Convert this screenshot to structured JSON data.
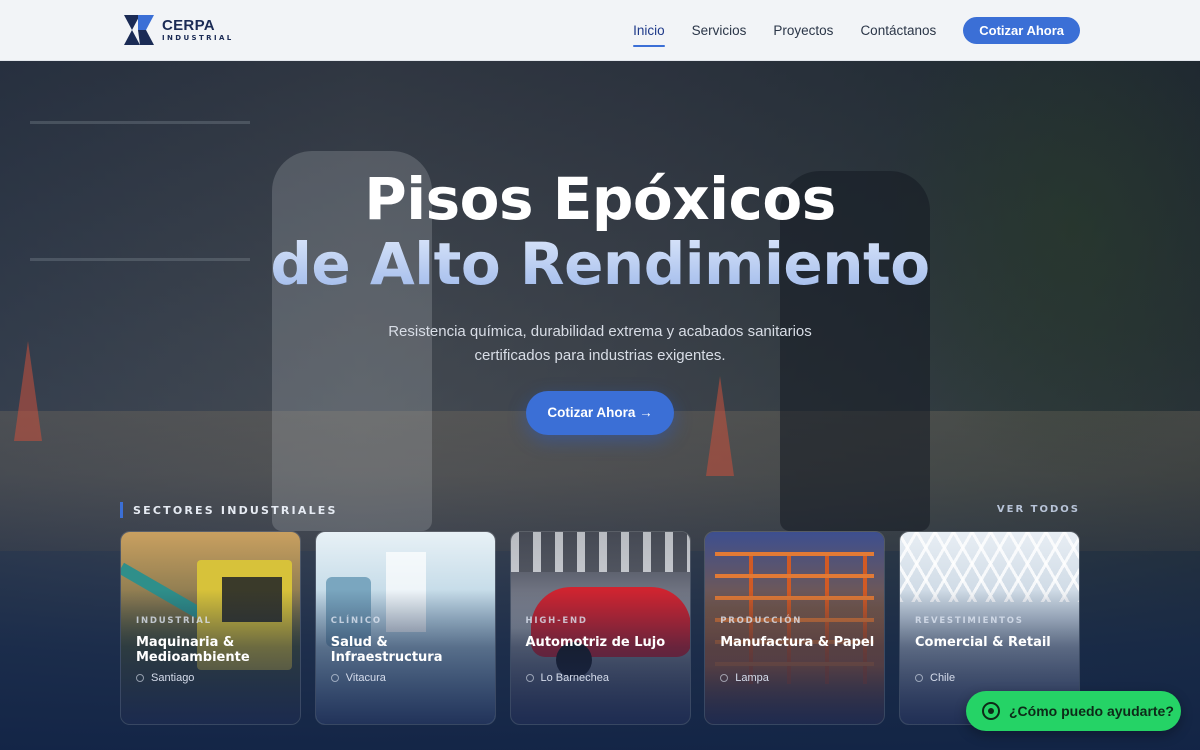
{
  "brand": {
    "name": "CERPA",
    "sub": "INDUSTRIAL"
  },
  "nav": {
    "links": [
      "Inicio",
      "Servicios",
      "Proyectos",
      "Contáctanos"
    ],
    "active": "Inicio",
    "cta": "Cotizar Ahora"
  },
  "hero": {
    "title_line1": "Pisos Epóxicos",
    "title_line2": "de Alto Rendimiento",
    "subtitle": "Resistencia química, durabilidad extrema y acabados sanitarios certificados para industrias exigentes.",
    "cta": "Cotizar Ahora →"
  },
  "sectors": {
    "heading": "SECTORES INDUSTRIALES",
    "see_all": "VER TODOS",
    "items": [
      {
        "tag": "INDUSTRIAL",
        "title": "Maquinaria & Medioambiente",
        "location": "Santiago"
      },
      {
        "tag": "CLÍNICO",
        "title": "Salud & Infraestructura",
        "location": "Vitacura"
      },
      {
        "tag": "HIGH-END",
        "title": "Automotriz de Lujo",
        "location": "Lo Barnechea"
      },
      {
        "tag": "PRODUCCIÓN",
        "title": "Manufactura & Papel",
        "location": "Lampa"
      },
      {
        "tag": "REVESTIMIENTOS",
        "title": "Comercial & Retail",
        "location": "Chile"
      }
    ]
  },
  "whatsapp": {
    "label": "¿Cómo puedo ayudarte?"
  },
  "colors": {
    "accent": "#3b6fd6",
    "nav_bg": "#f2f4f7",
    "whatsapp": "#25d366",
    "brand_navy": "#1b2b55"
  }
}
